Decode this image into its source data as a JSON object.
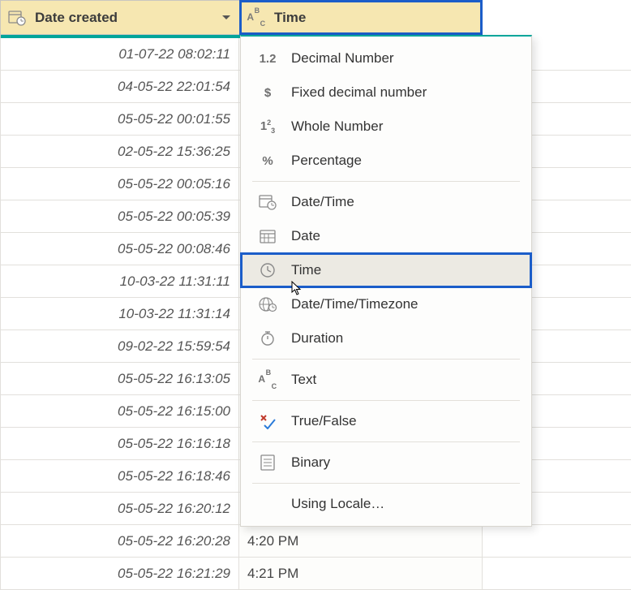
{
  "columns": {
    "date": {
      "label": "Date created"
    },
    "time": {
      "label": "Time"
    }
  },
  "rows": [
    {
      "date": "01-07-22 08:02:11",
      "time": ""
    },
    {
      "date": "04-05-22 22:01:54",
      "time": ""
    },
    {
      "date": "05-05-22 00:01:55",
      "time": ""
    },
    {
      "date": "02-05-22 15:36:25",
      "time": ""
    },
    {
      "date": "05-05-22 00:05:16",
      "time": ""
    },
    {
      "date": "05-05-22 00:05:39",
      "time": ""
    },
    {
      "date": "05-05-22 00:08:46",
      "time": ""
    },
    {
      "date": "10-03-22 11:31:11",
      "time": ""
    },
    {
      "date": "10-03-22 11:31:14",
      "time": ""
    },
    {
      "date": "09-02-22 15:59:54",
      "time": ""
    },
    {
      "date": "05-05-22 16:13:05",
      "time": ""
    },
    {
      "date": "05-05-22 16:15:00",
      "time": ""
    },
    {
      "date": "05-05-22 16:16:18",
      "time": ""
    },
    {
      "date": "05-05-22 16:18:46",
      "time": ""
    },
    {
      "date": "05-05-22 16:20:12",
      "time": ""
    },
    {
      "date": "05-05-22 16:20:28",
      "time": "4:20 PM"
    },
    {
      "date": "05-05-22 16:21:29",
      "time": "4:21 PM"
    }
  ],
  "menu": {
    "items": [
      {
        "id": "decimal",
        "label": "Decimal Number",
        "icon": "1.2"
      },
      {
        "id": "fixed",
        "label": "Fixed decimal number",
        "icon": "$"
      },
      {
        "id": "whole",
        "label": "Whole Number",
        "icon": "1²3"
      },
      {
        "id": "percent",
        "label": "Percentage",
        "icon": "%"
      },
      {
        "sep": true
      },
      {
        "id": "datetime",
        "label": "Date/Time",
        "icon": "datetime"
      },
      {
        "id": "date",
        "label": "Date",
        "icon": "date"
      },
      {
        "id": "time",
        "label": "Time",
        "icon": "clock",
        "highlighted": true
      },
      {
        "id": "dttz",
        "label": "Date/Time/Timezone",
        "icon": "globe-clock"
      },
      {
        "id": "duration",
        "label": "Duration",
        "icon": "duration"
      },
      {
        "sep": true
      },
      {
        "id": "text",
        "label": "Text",
        "icon": "ABC"
      },
      {
        "sep": true
      },
      {
        "id": "bool",
        "label": "True/False",
        "icon": "xcheck"
      },
      {
        "sep": true
      },
      {
        "id": "binary",
        "label": "Binary",
        "icon": "binary"
      },
      {
        "sep": true
      },
      {
        "id": "locale",
        "label": "Using Locale…",
        "icon": ""
      }
    ]
  }
}
